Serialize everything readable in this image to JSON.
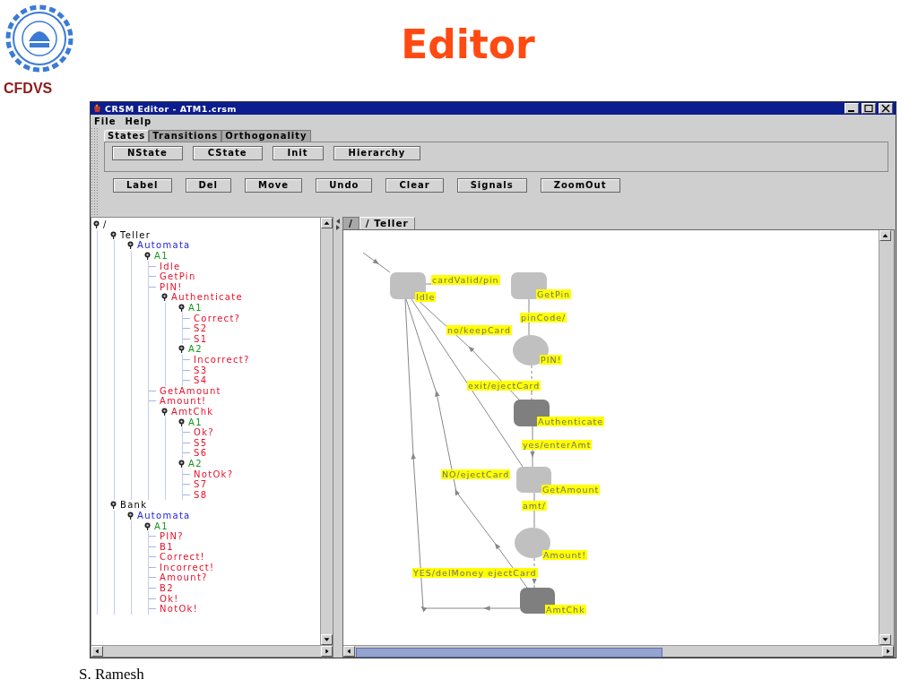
{
  "slide": {
    "logo_caption": "CFDVS",
    "title": "Editor",
    "footer": "S. Ramesh"
  },
  "window": {
    "title": "CRSM Editor - ATM1.crsm"
  },
  "menu": [
    "File",
    "Help"
  ],
  "tabs": [
    {
      "label": "States",
      "selected": true
    },
    {
      "label": "Transitions",
      "selected": false
    },
    {
      "label": "Orthogonality",
      "selected": false
    }
  ],
  "toolbar_rows": [
    [
      "NState",
      "CState",
      "Init",
      "Hierarchy"
    ],
    [
      "Label",
      "Del",
      "Move",
      "Undo",
      "Clear",
      "Signals",
      "ZoomOut"
    ]
  ],
  "tree": {
    "label": "/",
    "children": [
      {
        "label": "Teller",
        "children": [
          {
            "label": "Automata",
            "kind": "automata",
            "children": [
              {
                "label": "A1",
                "kind": "automaton",
                "children": [
                  {
                    "label": "Idle",
                    "kind": "state"
                  },
                  {
                    "label": "GetPin",
                    "kind": "state"
                  },
                  {
                    "label": "PIN!",
                    "kind": "state"
                  },
                  {
                    "label": "Authenticate",
                    "kind": "state",
                    "children": [
                      {
                        "label": "A1",
                        "kind": "automaton",
                        "children": [
                          {
                            "label": "Correct?",
                            "kind": "state"
                          },
                          {
                            "label": "S2",
                            "kind": "state"
                          },
                          {
                            "label": "S1",
                            "kind": "state"
                          }
                        ]
                      },
                      {
                        "label": "A2",
                        "kind": "automaton",
                        "children": [
                          {
                            "label": "Incorrect?",
                            "kind": "state"
                          },
                          {
                            "label": "S3",
                            "kind": "state"
                          },
                          {
                            "label": "S4",
                            "kind": "state"
                          }
                        ]
                      }
                    ]
                  },
                  {
                    "label": "GetAmount",
                    "kind": "state"
                  },
                  {
                    "label": "Amount!",
                    "kind": "state"
                  },
                  {
                    "label": "AmtChk",
                    "kind": "state",
                    "children": [
                      {
                        "label": "A1",
                        "kind": "automaton",
                        "children": [
                          {
                            "label": "Ok?",
                            "kind": "state"
                          },
                          {
                            "label": "S5",
                            "kind": "state"
                          },
                          {
                            "label": "S6",
                            "kind": "state"
                          }
                        ]
                      },
                      {
                        "label": "A2",
                        "kind": "automaton",
                        "children": [
                          {
                            "label": "NotOk?",
                            "kind": "state"
                          },
                          {
                            "label": "S7",
                            "kind": "state"
                          },
                          {
                            "label": "S8",
                            "kind": "state"
                          }
                        ]
                      }
                    ]
                  }
                ]
              }
            ]
          }
        ]
      },
      {
        "label": "Bank",
        "children": [
          {
            "label": "Automata",
            "kind": "automata",
            "children": [
              {
                "label": "A1",
                "kind": "automaton",
                "children": [
                  {
                    "label": "PIN?",
                    "kind": "state"
                  },
                  {
                    "label": "B1",
                    "kind": "state"
                  },
                  {
                    "label": "Correct!",
                    "kind": "state"
                  },
                  {
                    "label": "Incorrect!",
                    "kind": "state"
                  },
                  {
                    "label": "Amount?",
                    "kind": "state"
                  },
                  {
                    "label": "B2",
                    "kind": "state"
                  },
                  {
                    "label": "Ok!",
                    "kind": "state"
                  },
                  {
                    "label": "NotOk!",
                    "kind": "state"
                  }
                ]
              }
            ]
          }
        ]
      }
    ]
  },
  "diagram": {
    "tabs": [
      {
        "label": "/",
        "selected": false
      },
      {
        "label": "/ Teller",
        "selected": true
      }
    ],
    "states": [
      {
        "name": "Idle",
        "kind": "basic"
      },
      {
        "name": "GetPin",
        "kind": "basic"
      },
      {
        "name": "PIN!",
        "kind": "signal"
      },
      {
        "name": "Authenticate",
        "kind": "composite"
      },
      {
        "name": "GetAmount",
        "kind": "basic"
      },
      {
        "name": "Amount!",
        "kind": "signal"
      },
      {
        "name": "AmtChk",
        "kind": "composite"
      }
    ],
    "transition_labels": [
      "cardValid/pin",
      "pinCode/",
      "no/keepCard",
      "exit/ejectCard",
      "yes/enterAmt",
      "NO/ejectCard",
      "amt/",
      "YES/delMoney ejectCard"
    ]
  }
}
